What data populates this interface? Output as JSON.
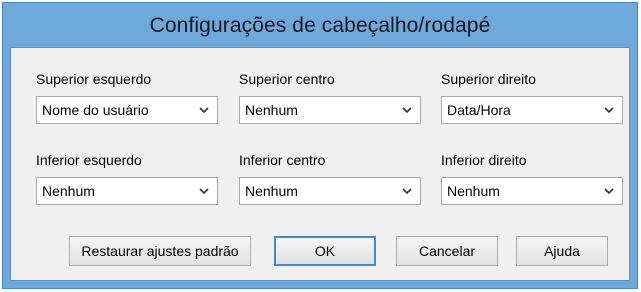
{
  "dialog": {
    "title": "Configurações de cabeçalho/rodapé"
  },
  "fields": {
    "top_left": {
      "label": "Superior esquerdo",
      "value": "Nome do usuário"
    },
    "top_center": {
      "label": "Superior centro",
      "value": "Nenhum"
    },
    "top_right": {
      "label": "Superior direito",
      "value": "Data/Hora"
    },
    "bottom_left": {
      "label": "Inferior esquerdo",
      "value": "Nenhum"
    },
    "bottom_center": {
      "label": "Inferior centro",
      "value": "Nenhum"
    },
    "bottom_right": {
      "label": "Inferior direito",
      "value": "Nenhum"
    }
  },
  "buttons": {
    "restore": "Restaurar ajustes padrão",
    "ok": "OK",
    "cancel": "Cancelar",
    "help": "Ajuda"
  },
  "icons": {
    "dropdown": "chevron-down-icon"
  },
  "colors": {
    "frame": "#6fa9dc",
    "client": "#f0f0f0",
    "default_button_border": "#3c8bd9"
  }
}
